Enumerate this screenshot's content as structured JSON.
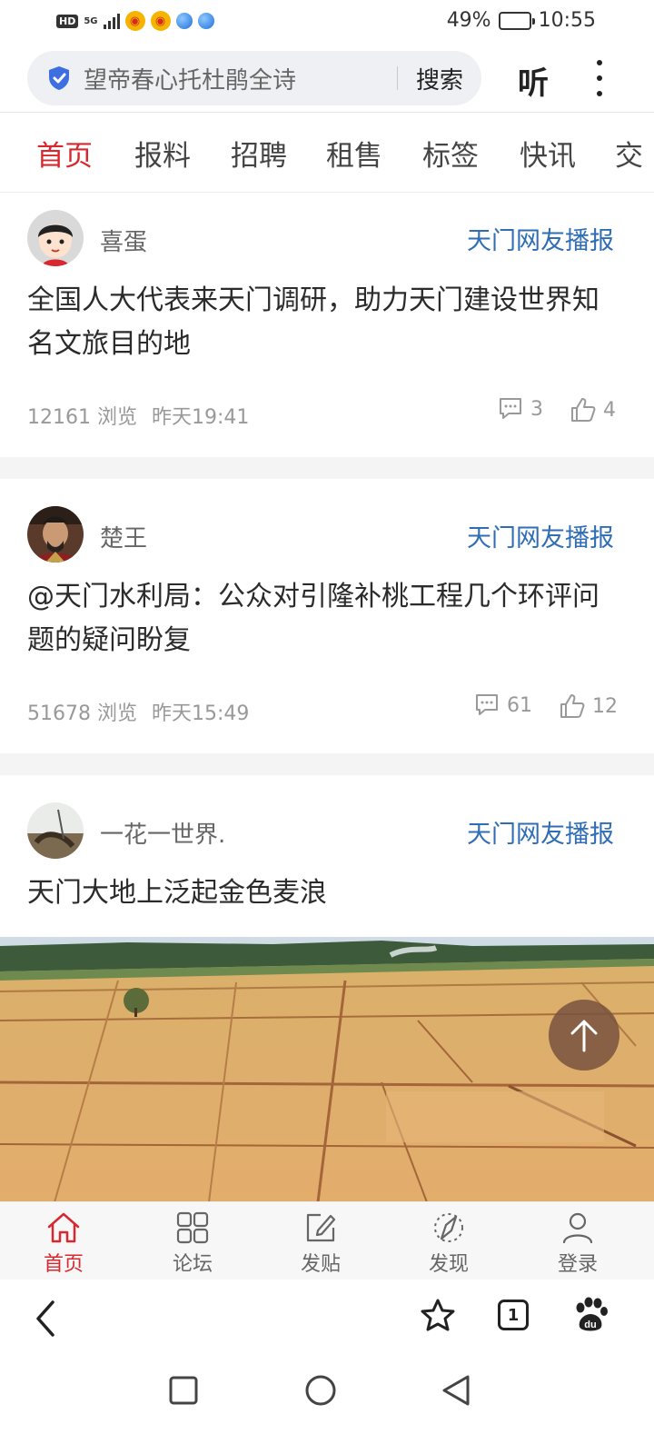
{
  "status_bar": {
    "hd": "HD",
    "network": "5G",
    "battery_percent": "49%",
    "battery_level": 0.49,
    "time": "10:55"
  },
  "search": {
    "query": "望帝春心托杜鹃全诗",
    "button": "搜索",
    "listen": "听"
  },
  "tabs": [
    {
      "label": "首页",
      "active": true
    },
    {
      "label": "报料",
      "active": false
    },
    {
      "label": "招聘",
      "active": false
    },
    {
      "label": "租售",
      "active": false
    },
    {
      "label": "标签",
      "active": false
    },
    {
      "label": "快讯",
      "active": false
    },
    {
      "label": "交",
      "active": false
    }
  ],
  "posts": [
    {
      "author": "喜蛋",
      "source": "天门网友播报",
      "title": "全国人大代表来天门调研，助力天门建设世界知名文旅目的地",
      "views": "12161 浏览",
      "time": "昨天19:41",
      "comments": "3",
      "likes": "4"
    },
    {
      "author": "楚王",
      "source": "天门网友播报",
      "title": "@天门水利局：公众对引隆补桃工程几个环评问题的疑问盼复",
      "views": "51678 浏览",
      "time": "昨天15:49",
      "comments": "61",
      "likes": "12"
    },
    {
      "author": "一花一世界.",
      "source": "天门网友播报",
      "title": "天门大地上泛起金色麦浪"
    }
  ],
  "app_nav": [
    {
      "label": "首页",
      "icon": "home-icon",
      "active": true
    },
    {
      "label": "论坛",
      "icon": "grid-icon",
      "active": false
    },
    {
      "label": "发贴",
      "icon": "edit-icon",
      "active": false
    },
    {
      "label": "发现",
      "icon": "compass-icon",
      "active": false
    },
    {
      "label": "登录",
      "icon": "user-icon",
      "active": false
    }
  ],
  "browser": {
    "tab_count": "1"
  },
  "colors": {
    "accent_red": "#d7282f",
    "source_blue": "#2f6db5",
    "muted_gray": "#999999"
  }
}
